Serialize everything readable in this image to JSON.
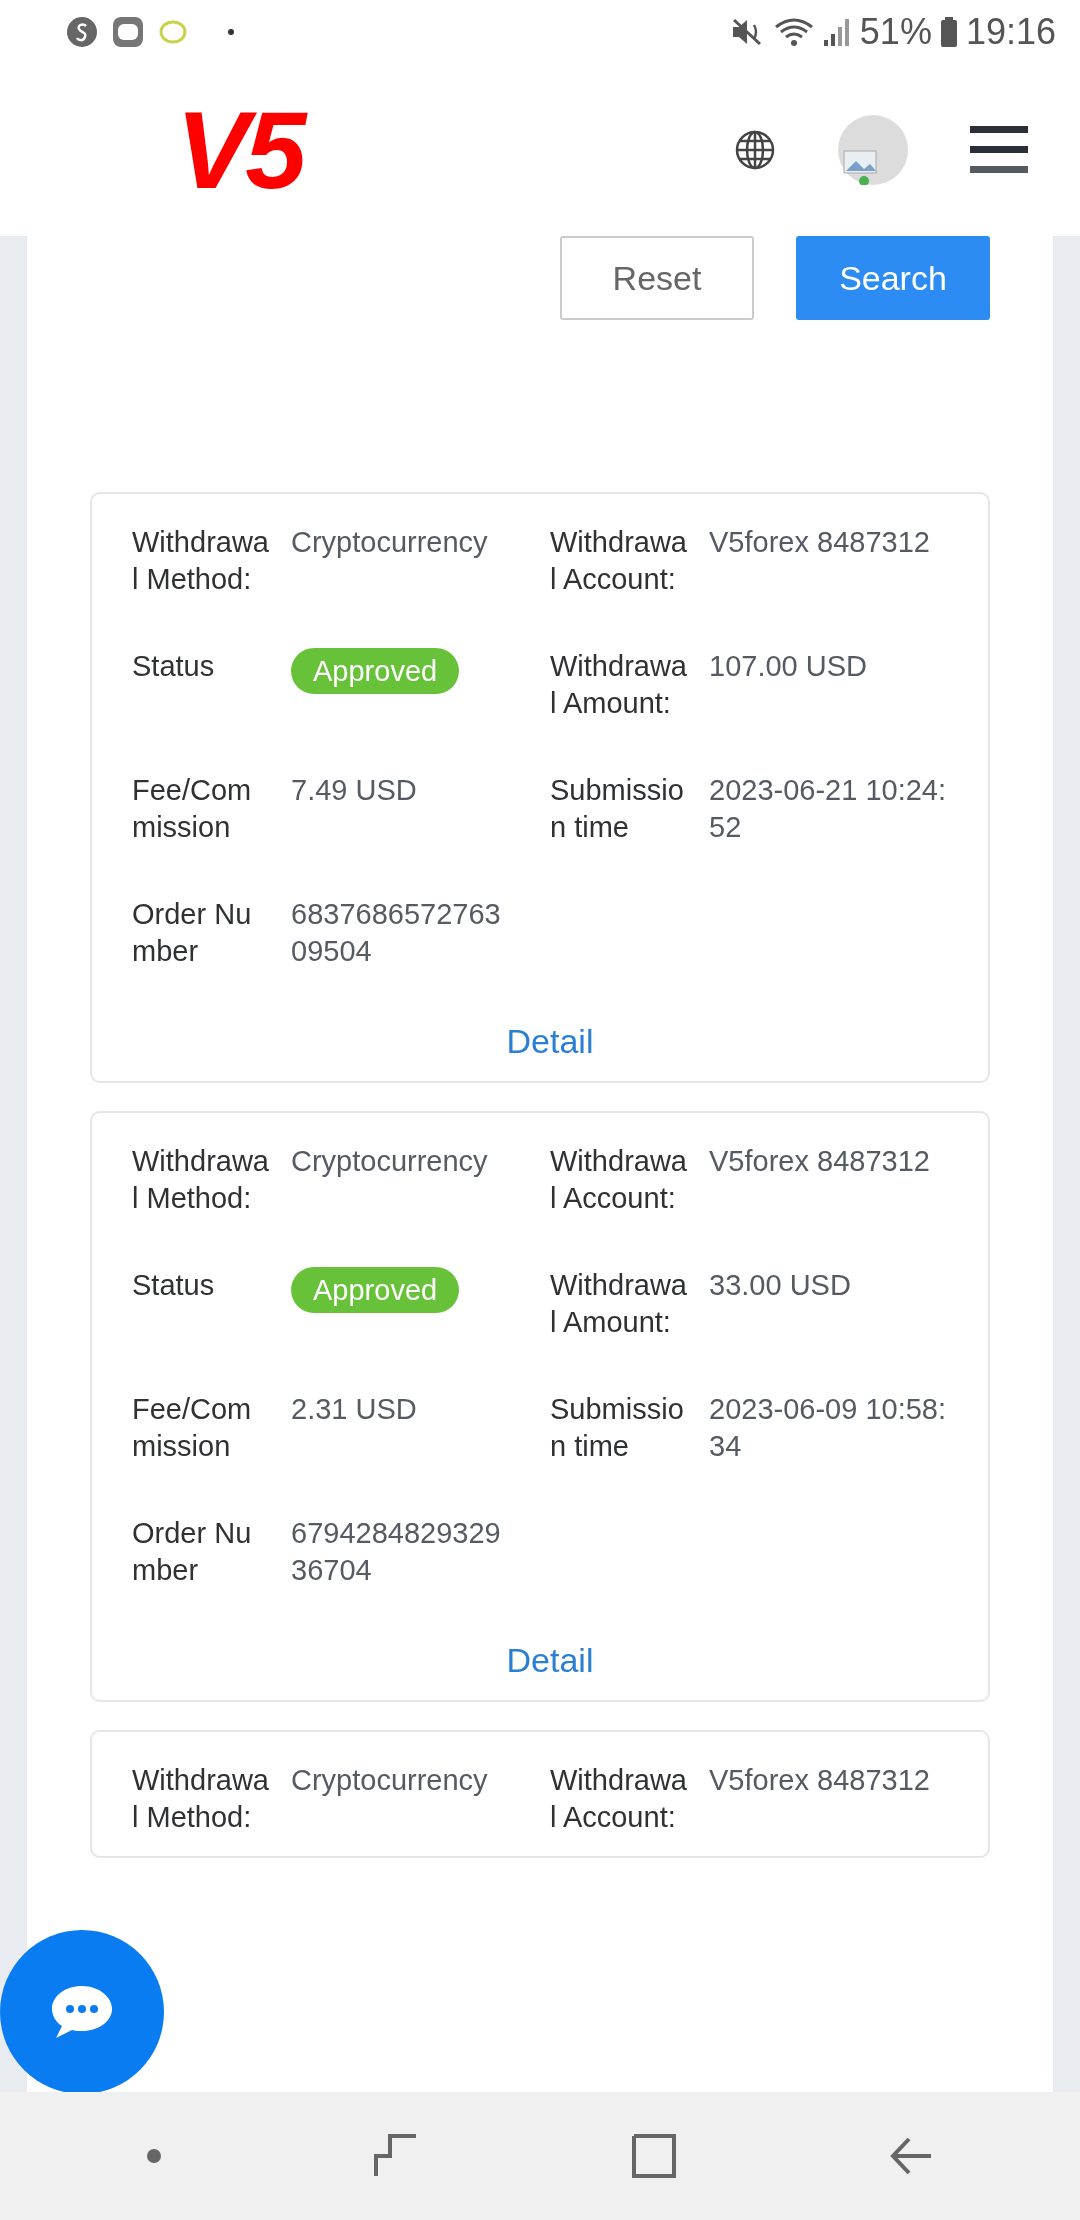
{
  "status_bar": {
    "battery": "51%",
    "time": "19:16"
  },
  "header": {
    "logo": "V5"
  },
  "filter_buttons": [
    {
      "label": "Reset",
      "kind": "plain"
    },
    {
      "label": "Search",
      "kind": "primary"
    }
  ],
  "records": [
    {
      "fields": [
        {
          "label": "Withdrawal Method:",
          "value": "Cryptocurrency"
        },
        {
          "label": "Withdrawal Account:",
          "value": "V5forex 8487312"
        },
        {
          "label": "Status",
          "value": "Approved",
          "kind": "badge"
        },
        {
          "label": "Withdrawal Amount:",
          "value": "107.00 USD"
        },
        {
          "label": "Fee/Commission",
          "value": "7.49 USD"
        },
        {
          "label": "Submission time",
          "value": "2023-06-21 10:24:52"
        },
        {
          "label": "Order Number",
          "value": "683768657276309504"
        }
      ],
      "link": "Detail"
    },
    {
      "fields": [
        {
          "label": "Withdrawal Method:",
          "value": "Cryptocurrency"
        },
        {
          "label": "Withdrawal Account:",
          "value": "V5forex 8487312"
        },
        {
          "label": "Status",
          "value": "Approved",
          "kind": "badge"
        },
        {
          "label": "Withdrawal Amount:",
          "value": "33.00 USD"
        },
        {
          "label": "Fee/Commission",
          "value": "2.31 USD"
        },
        {
          "label": "Submission time",
          "value": "2023-06-09 10:58:34"
        },
        {
          "label": "Order Number",
          "value": "679428482932936704"
        }
      ],
      "link": "Detail"
    },
    {
      "fields": [
        {
          "label": "Withdrawal Method:",
          "value": "Cryptocurrency"
        },
        {
          "label": "Withdrawal Account:",
          "value": "V5forex 8487312"
        }
      ]
    }
  ]
}
